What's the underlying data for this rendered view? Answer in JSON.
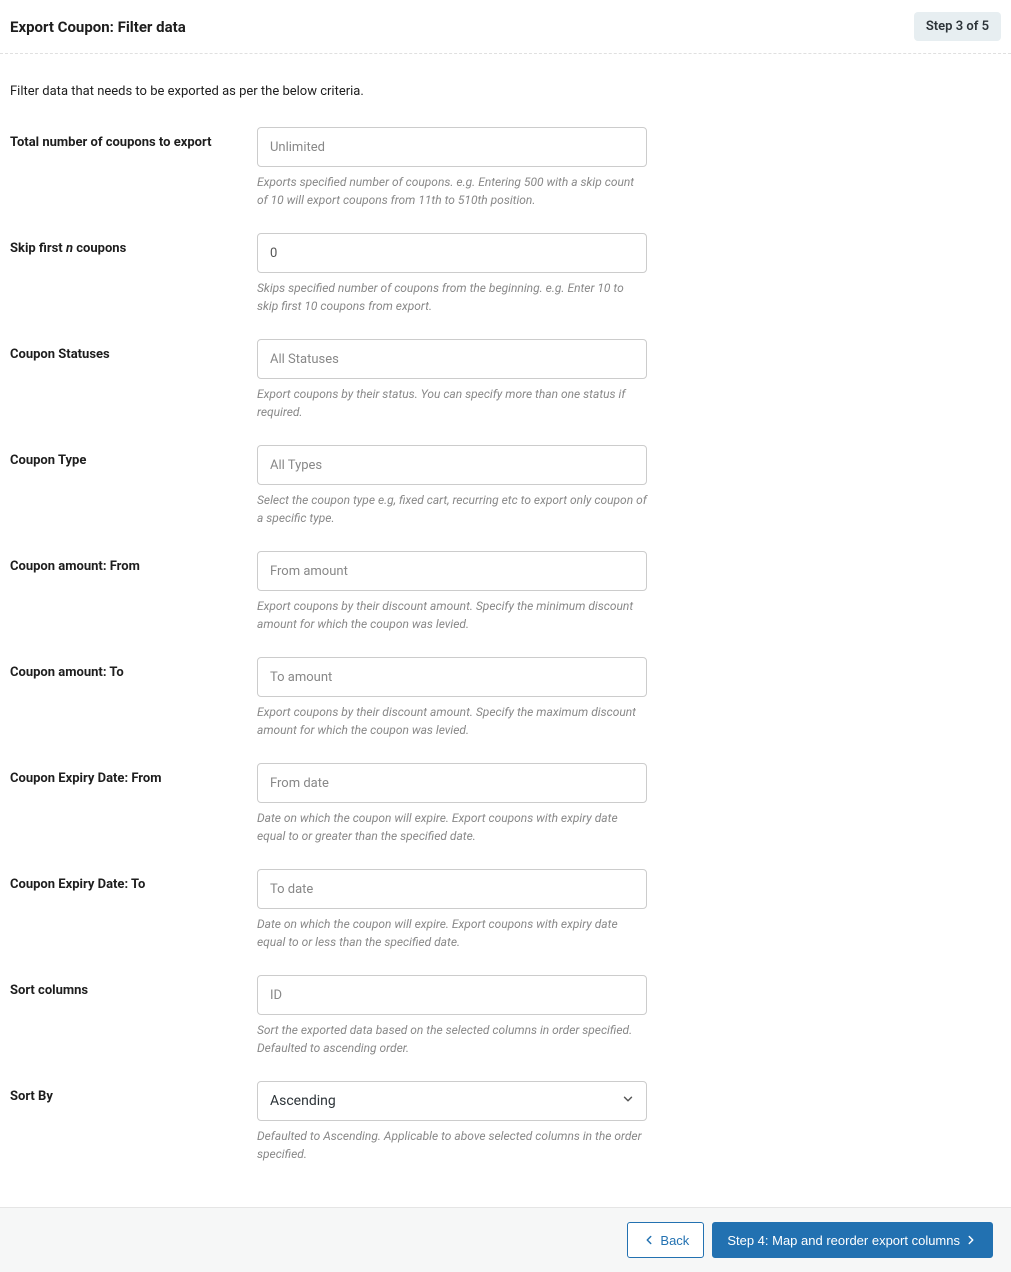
{
  "header": {
    "title": "Export Coupon: Filter data",
    "step_badge": "Step 3 of 5"
  },
  "intro": "Filter data that needs to be exported as per the below criteria.",
  "fields": {
    "total": {
      "label": "Total number of coupons to export",
      "placeholder": "Unlimited",
      "help": "Exports specified number of coupons. e.g. Entering 500 with a skip count of 10 will export coupons from 11th to 510th position."
    },
    "skip": {
      "label_pre": "Skip first ",
      "label_em": "n",
      "label_post": " coupons",
      "value": "0",
      "help": "Skips specified number of coupons from the beginning. e.g. Enter 10 to skip first 10 coupons from export."
    },
    "statuses": {
      "label": "Coupon Statuses",
      "placeholder": "All Statuses",
      "help": "Export coupons by their status. You can specify more than one status if required."
    },
    "type": {
      "label": "Coupon Type",
      "placeholder": "All Types",
      "help": "Select the coupon type e.g, fixed cart, recurring etc to export only coupon of a specific type."
    },
    "amount_from": {
      "label": "Coupon amount: From",
      "placeholder": "From amount",
      "help": "Export coupons by their discount amount. Specify the minimum discount amount for which the coupon was levied."
    },
    "amount_to": {
      "label": "Coupon amount: To",
      "placeholder": "To amount",
      "help": "Export coupons by their discount amount. Specify the maximum discount amount for which the coupon was levied."
    },
    "expiry_from": {
      "label": "Coupon Expiry Date: From",
      "placeholder": "From date",
      "help": "Date on which the coupon will expire. Export coupons with expiry date equal to or greater than the specified date."
    },
    "expiry_to": {
      "label": "Coupon Expiry Date: To",
      "placeholder": "To date",
      "help": "Date on which the coupon will expire. Export coupons with expiry date equal to or less than the specified date."
    },
    "sort_columns": {
      "label": "Sort columns",
      "value": "ID",
      "help": "Sort the exported data based on the selected columns in order specified. Defaulted to ascending order."
    },
    "sort_by": {
      "label": "Sort By",
      "value": "Ascending",
      "help": "Defaulted to Ascending. Applicable to above selected columns in the order specified."
    }
  },
  "footer": {
    "back": "Back",
    "next": "Step 4: Map and reorder export columns"
  }
}
